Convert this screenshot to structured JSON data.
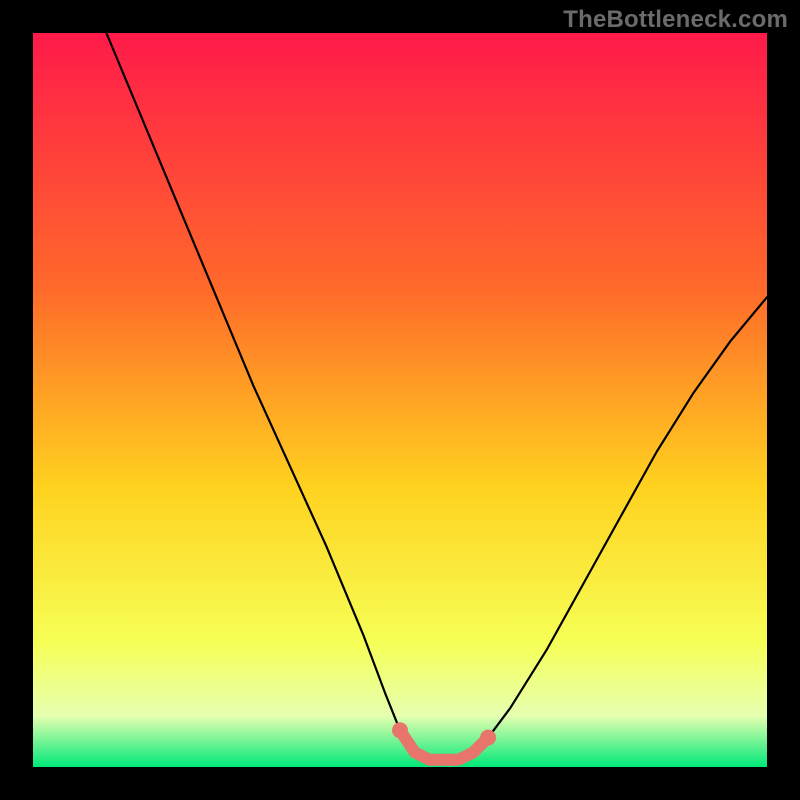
{
  "watermark": "TheBottleneck.com",
  "colors": {
    "gradient_top": "#ff1a4a",
    "gradient_mid1": "#ff6a2a",
    "gradient_mid2": "#ffd21f",
    "gradient_low": "#f6ff56",
    "gradient_pale": "#e6ffb0",
    "gradient_bottom": "#00e878",
    "curve": "#000000",
    "marker": "#e8756b"
  },
  "chart_data": {
    "type": "line",
    "title": "",
    "xlabel": "",
    "ylabel": "",
    "xlim": [
      0,
      100
    ],
    "ylim": [
      0,
      100
    ],
    "series": [
      {
        "name": "bottleneck-curve",
        "x": [
          10,
          15,
          20,
          25,
          30,
          35,
          40,
          45,
          48,
          50,
          52,
          54,
          56,
          58,
          60,
          62,
          65,
          70,
          75,
          80,
          85,
          90,
          95,
          100
        ],
        "y": [
          100,
          88,
          76,
          64,
          52,
          41,
          30,
          18,
          10,
          5,
          2,
          1,
          1,
          1,
          2,
          4,
          8,
          16,
          25,
          34,
          43,
          51,
          58,
          64
        ]
      }
    ],
    "markers": {
      "name": "highlight-band",
      "x": [
        50,
        52,
        54,
        56,
        58,
        60,
        62
      ],
      "y": [
        5,
        2,
        1,
        1,
        1,
        2,
        4
      ]
    }
  }
}
